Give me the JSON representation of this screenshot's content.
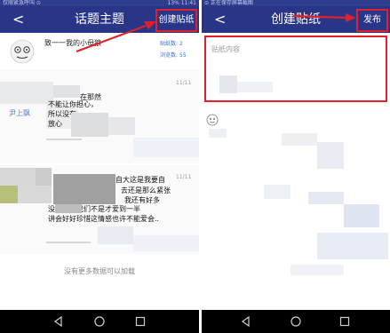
{
  "left": {
    "status": {
      "left": "仅限紧急呼叫 ⊙",
      "right": "13%  11:41"
    },
    "title": "话题主题",
    "create_label": "创建贴纸",
    "topic": {
      "title": "致一一我的小母狼",
      "stats": [
        {
          "label": "贴纸数:",
          "value": "2"
        },
        {
          "label": "浏览数:",
          "value": "55"
        }
      ]
    },
    "posts": [
      {
        "user": "尹上飘",
        "date": "11/11",
        "lines": [
          "在那然",
          "不能让你担心，",
          "所以没有",
          "放心"
        ]
      },
      {
        "user": "",
        "date": "11/11",
        "lines": [
          "自大这是我要自",
          "去还是那么紧张",
          "我还有好多",
          "没有变完我们不是才爱到一半",
          "讲会好好珍惜这情感也许不能爱会.."
        ]
      }
    ],
    "no_more": "没有更多数据可以加载"
  },
  "right": {
    "status": {
      "left": "⊙ 正在保存屏幕截图",
      "right": ""
    },
    "title": "创建贴纸",
    "publish_label": "发布",
    "content_placeholder": "贴纸内容"
  },
  "colors": {
    "appbar": "#293688",
    "highlight": "#e0202a",
    "link": "#3f6fc5"
  }
}
